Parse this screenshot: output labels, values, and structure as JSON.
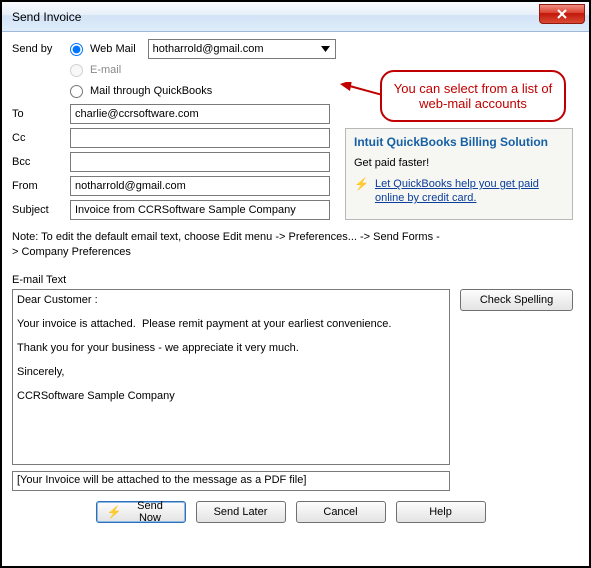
{
  "window": {
    "title": "Send Invoice",
    "close_glyph": "X"
  },
  "send_by": {
    "label": "Send by",
    "options": {
      "web_mail": "Web Mail",
      "email": "E-mail",
      "mail_qb": "Mail through QuickBooks"
    },
    "selected": "web_mail",
    "account_dropdown_value": "hotharrold@gmail.com"
  },
  "fields": {
    "to_label": "To",
    "to_value": "charlie@ccrsoftware.com",
    "cc_label": "Cc",
    "cc_value": "",
    "bcc_label": "Bcc",
    "bcc_value": "",
    "from_label": "From",
    "from_value": "notharrold@gmail.com",
    "subject_label": "Subject",
    "subject_value": "Invoice from CCRSoftware Sample Company"
  },
  "callout": {
    "text": "You can select from a list of web-mail accounts"
  },
  "promo": {
    "title": "Intuit QuickBooks Billing Solution",
    "subtitle": "Get paid faster!",
    "link_text": "Let QuickBooks help you get paid online by credit card."
  },
  "note": "Note: To edit the default email text, choose Edit menu -> Preferences... -> Send Forms -> Company Preferences",
  "email_text": {
    "label": "E-mail Text",
    "body": "Dear Customer :\n\nYour invoice is attached.  Please remit payment at your earliest convenience.\n\nThank you for your business - we appreciate it very much.\n\nSincerely,\n\nCCRSoftware Sample Company"
  },
  "attach_note": "[Your Invoice will be attached to the message as a PDF file]",
  "buttons": {
    "check_spelling": "Check Spelling",
    "send_now": "Send Now",
    "send_later": "Send Later",
    "cancel": "Cancel",
    "help": "Help"
  }
}
